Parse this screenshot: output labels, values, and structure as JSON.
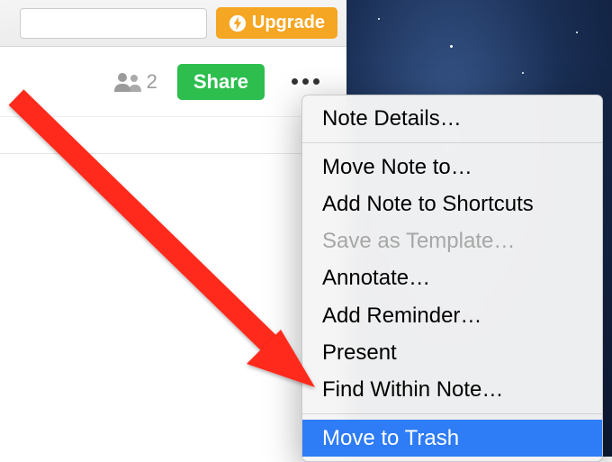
{
  "titlebar": {
    "upgrade_label": "Upgrade"
  },
  "toolbar": {
    "collaborator_count": "2",
    "share_label": "Share"
  },
  "menu": {
    "items": [
      {
        "label": "Note Details…",
        "enabled": true
      },
      {
        "label": "Move Note to…",
        "enabled": true
      },
      {
        "label": "Add Note to Shortcuts",
        "enabled": true
      },
      {
        "label": "Save as Template…",
        "enabled": false
      },
      {
        "label": "Annotate…",
        "enabled": true
      },
      {
        "label": "Add Reminder…",
        "enabled": true
      },
      {
        "label": "Present",
        "enabled": true
      },
      {
        "label": "Find Within Note…",
        "enabled": true
      },
      {
        "label": "Move to Trash",
        "enabled": true,
        "highlighted": true
      }
    ]
  }
}
